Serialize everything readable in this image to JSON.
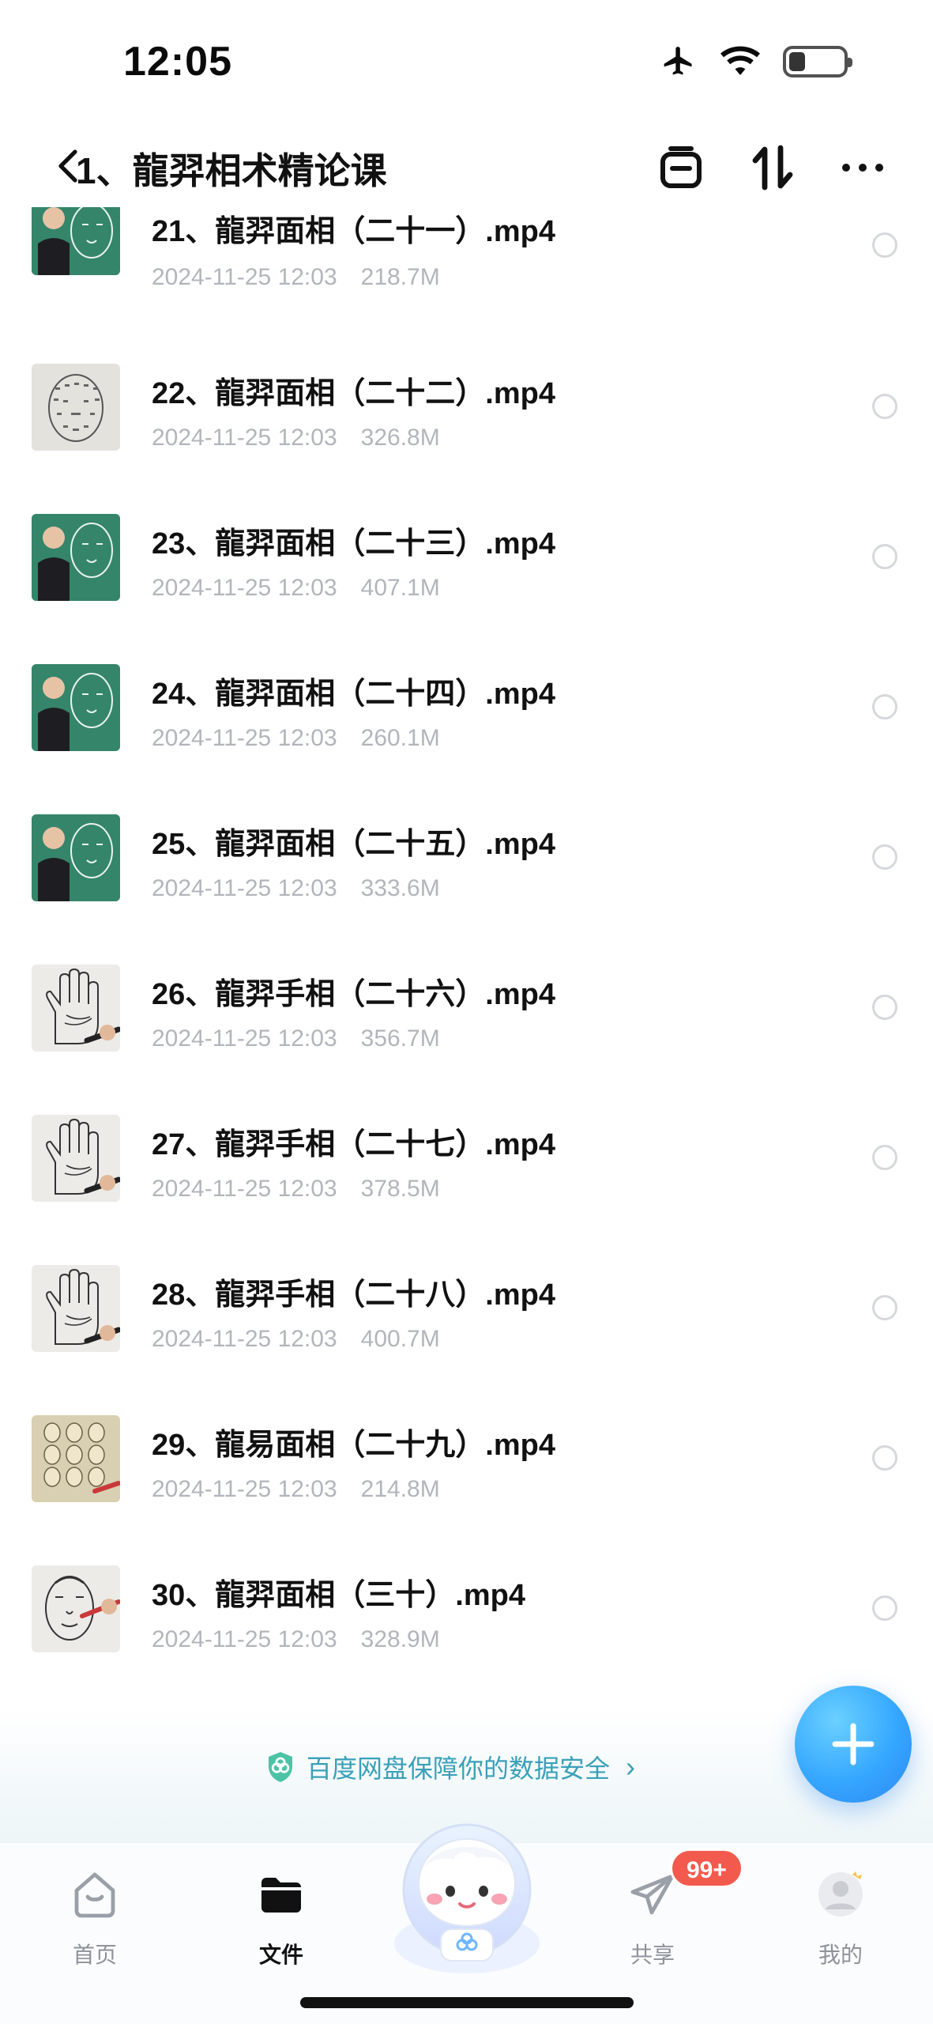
{
  "status_bar": {
    "time": "12:05",
    "battery_level": 0.3,
    "icons": [
      "airplane-icon",
      "wifi-icon",
      "battery-icon"
    ]
  },
  "header": {
    "title": "1、龍羿相术精论课",
    "back_icon": "chevron-left-icon",
    "actions": [
      "select-box-icon",
      "sort-icon",
      "more-icon"
    ]
  },
  "files": [
    {
      "name": "21、龍羿面相（二十一）.mp4",
      "date": "2024-11-25 12:03",
      "size": "218.7M",
      "thumb": "face-chart-green"
    },
    {
      "name": "22、龍羿面相（二十二）.mp4",
      "date": "2024-11-25 12:03",
      "size": "326.8M",
      "thumb": "face-chart-paper"
    },
    {
      "name": "23、龍羿面相（二十三）.mp4",
      "date": "2024-11-25 12:03",
      "size": "407.1M",
      "thumb": "face-chart-green"
    },
    {
      "name": "24、龍羿面相（二十四）.mp4",
      "date": "2024-11-25 12:03",
      "size": "260.1M",
      "thumb": "face-chart-green"
    },
    {
      "name": "25、龍羿面相（二十五）.mp4",
      "date": "2024-11-25 12:03",
      "size": "333.6M",
      "thumb": "face-chart-green"
    },
    {
      "name": "26、龍羿手相（二十六）.mp4",
      "date": "2024-11-25 12:03",
      "size": "356.7M",
      "thumb": "palm-drawing"
    },
    {
      "name": "27、龍羿手相（二十七）.mp4",
      "date": "2024-11-25 12:03",
      "size": "378.5M",
      "thumb": "palm-drawing"
    },
    {
      "name": "28、龍羿手相（二十八）.mp4",
      "date": "2024-11-25 12:03",
      "size": "400.7M",
      "thumb": "palm-drawing"
    },
    {
      "name": "29、龍易面相（二十九）.mp4",
      "date": "2024-11-25 12:03",
      "size": "214.8M",
      "thumb": "face-grid-paper"
    },
    {
      "name": "30、龍羿面相（三十）.mp4",
      "date": "2024-11-25 12:03",
      "size": "328.9M",
      "thumb": "face-sketch-paper"
    }
  ],
  "banner": {
    "text": "百度网盘保障你的数据安全",
    "icon": "shield-icon"
  },
  "fab": {
    "icon": "plus-icon"
  },
  "tabs": [
    {
      "label": "首页",
      "icon": "home-icon",
      "active": false
    },
    {
      "label": "文件",
      "icon": "folder-icon",
      "active": true
    },
    {
      "label": "",
      "icon": "mascot-icon",
      "active": false
    },
    {
      "label": "共享",
      "icon": "send-icon",
      "active": false,
      "badge": "99+"
    },
    {
      "label": "我的",
      "icon": "avatar-icon",
      "active": false
    }
  ],
  "colors": {
    "meta_text": "#b2b5bb",
    "banner_text": "#3aa0b8",
    "fab": "#35a7ff",
    "badge": "#f25a4e"
  }
}
